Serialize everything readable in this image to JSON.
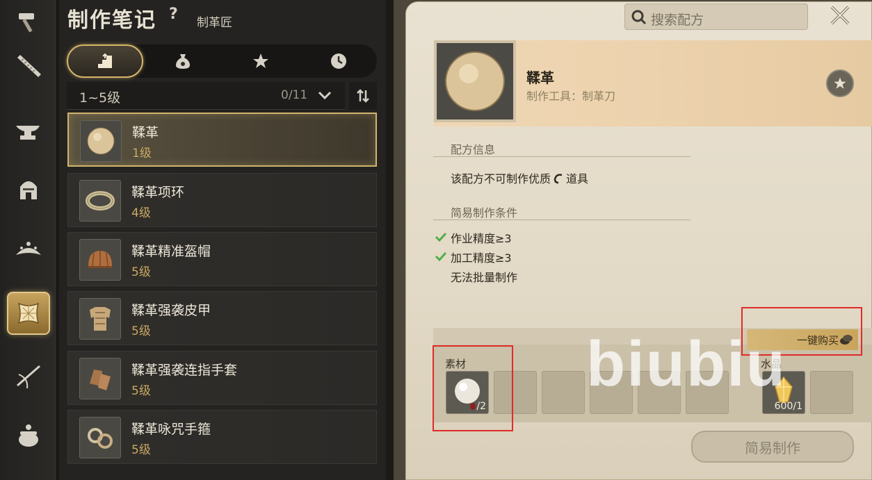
{
  "header": {
    "title": "制作笔记",
    "help": "?",
    "subtitle": "制革匠"
  },
  "categories": [
    {
      "icon": "hammer-icon"
    },
    {
      "icon": "saw-icon"
    },
    {
      "icon": "anvil-icon"
    },
    {
      "icon": "helmet-icon"
    },
    {
      "icon": "tiara-icon"
    },
    {
      "icon": "leather-hide-icon",
      "active": true
    },
    {
      "icon": "needle-icon"
    },
    {
      "icon": "cauldron-icon"
    }
  ],
  "tabs": [
    {
      "icon": "level-stairs-icon",
      "active": true
    },
    {
      "icon": "money-bag-icon"
    },
    {
      "icon": "star-icon"
    },
    {
      "icon": "clock-icon"
    }
  ],
  "filter": {
    "label": "1~5级",
    "count": "0/11"
  },
  "recipes": [
    {
      "name": "鞣革",
      "level": "1级",
      "icon": "leather-ball-icon"
    },
    {
      "name": "鞣革项环",
      "level": "4级",
      "icon": "leather-ring-icon"
    },
    {
      "name": "鞣革精准盔帽",
      "level": "5级",
      "icon": "leather-cap-icon"
    },
    {
      "name": "鞣革强袭皮甲",
      "level": "5级",
      "icon": "leather-armor-icon"
    },
    {
      "name": "鞣革强袭连指手套",
      "level": "5级",
      "icon": "leather-gloves-icon"
    },
    {
      "name": "鞣革咏咒手箍",
      "level": "5级",
      "icon": "leather-bracer-icon"
    }
  ],
  "search": {
    "placeholder": "搜索配方"
  },
  "detail": {
    "name": "鞣革",
    "tool": "制作工具：制革刀",
    "section1_title": "配方信息",
    "section1_text_a": "该配方不可制作优质",
    "section1_text_b": "道具",
    "section2_title": "简易制作条件",
    "conditions": [
      {
        "text": "作业精度≥3",
        "met": true
      },
      {
        "text": "加工精度≥3",
        "met": true
      },
      {
        "text": "无法批量制作",
        "met": false
      }
    ],
    "buy_label": "一键购买",
    "materials_label": "素材",
    "material_qty": "/2",
    "crystal_label": "水晶",
    "crystal_qty": "600/1",
    "craft_label": "简易制作"
  },
  "watermark": "biubiu",
  "colors": {
    "accent_gold": "#d2b56c",
    "highlight_red": "#e02a2a",
    "level_gold": "#c9a962",
    "check_green": "#4fae4a"
  }
}
